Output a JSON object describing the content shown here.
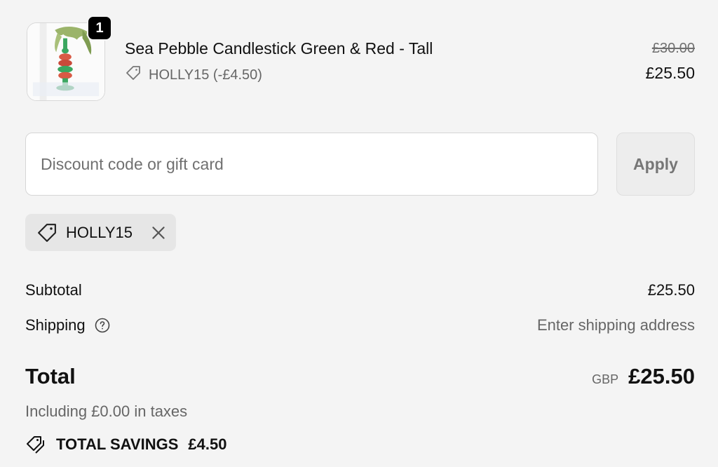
{
  "line_item": {
    "quantity": "1",
    "name": "Sea Pebble Candlestick Green & Red - Tall",
    "discount": "HOLLY15 (-£4.50)",
    "original_price": "£30.00",
    "price": "£25.50",
    "image": "candlestick-thumbnail"
  },
  "discount_form": {
    "placeholder": "Discount code or gift card",
    "value": "",
    "apply_label": "Apply"
  },
  "applied_code": {
    "code": "HOLLY15"
  },
  "summary": {
    "subtotal_label": "Subtotal",
    "subtotal_value": "£25.50",
    "shipping_label": "Shipping",
    "shipping_value": "Enter shipping address",
    "total_label": "Total",
    "currency": "GBP",
    "total_value": "£25.50",
    "taxes_note": "Including £0.00 in taxes",
    "savings_label": "TOTAL SAVINGS",
    "savings_value": "£4.50"
  },
  "icons": {
    "tag": "tag-icon",
    "remove": "close-icon",
    "help": "help-circle-icon",
    "savings": "tags-icon"
  },
  "colors": {
    "background": "#f4f4f4",
    "text": "#111111",
    "muted": "#666666",
    "badge": "#000000"
  }
}
